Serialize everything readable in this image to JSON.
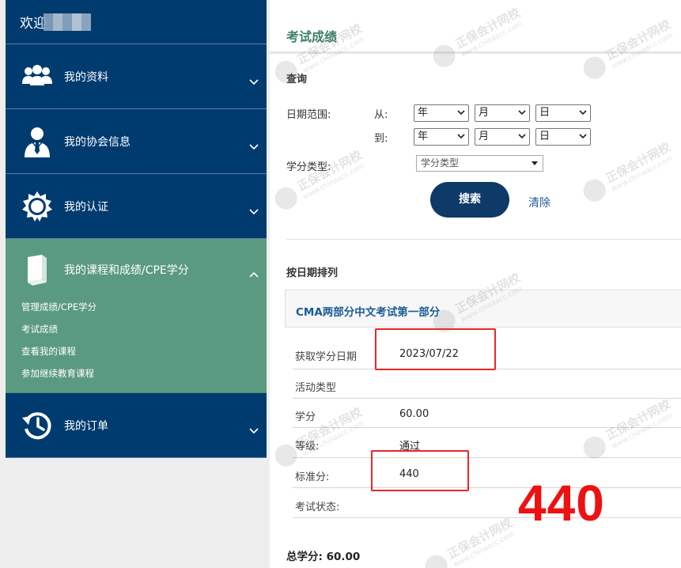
{
  "sidebar": {
    "welcome": "欢迎",
    "items": [
      {
        "label": "我的资料",
        "icon": "users-icon"
      },
      {
        "label": "我的协会信息",
        "icon": "person-tie-icon"
      },
      {
        "label": "我的认证",
        "icon": "badge-seal-icon"
      }
    ],
    "active": {
      "label": "我的课程和成绩/CPE学分",
      "icon": "book-icon",
      "sub": [
        "管理成绩/CPE学分",
        "考试成绩",
        "查看我的课程",
        "参加继续教育课程"
      ]
    },
    "orders": {
      "label": "我的订单",
      "icon": "history-icon"
    }
  },
  "main": {
    "title": "考试成绩",
    "query": {
      "heading": "查询",
      "date_range_label": "日期范围:",
      "from_label": "从:",
      "to_label": "到:",
      "year": "年",
      "month": "月",
      "day": "日",
      "credit_type_label": "学分类型:",
      "credit_type_value": "学分类型",
      "search_button": "搜索",
      "clear_link": "清除"
    },
    "sort": {
      "heading": "按日期排列"
    },
    "exam": {
      "title": "CMA两部分中文考试第一部分",
      "rows": [
        {
          "label": "获取学分日期",
          "value": "2023/07/22"
        },
        {
          "label": "活动类型",
          "value": ""
        },
        {
          "label": "学分",
          "value": "60.00"
        },
        {
          "label": "等级:",
          "value": "通过"
        },
        {
          "label": "标准分:",
          "value": "440"
        },
        {
          "label": "考试状态:",
          "value": ""
        }
      ]
    },
    "annotation": "440",
    "total": "总学分: 60.00"
  },
  "watermark": {
    "line1": "正保会计网校",
    "line2": "www.chinaacc.com"
  },
  "colors": {
    "sidebar_bg": "#003b6f",
    "active_bg": "#5a9a80",
    "title_green": "#3d7f6c",
    "button_bg": "#0d3a66",
    "highlight_red": "#e8262a"
  }
}
